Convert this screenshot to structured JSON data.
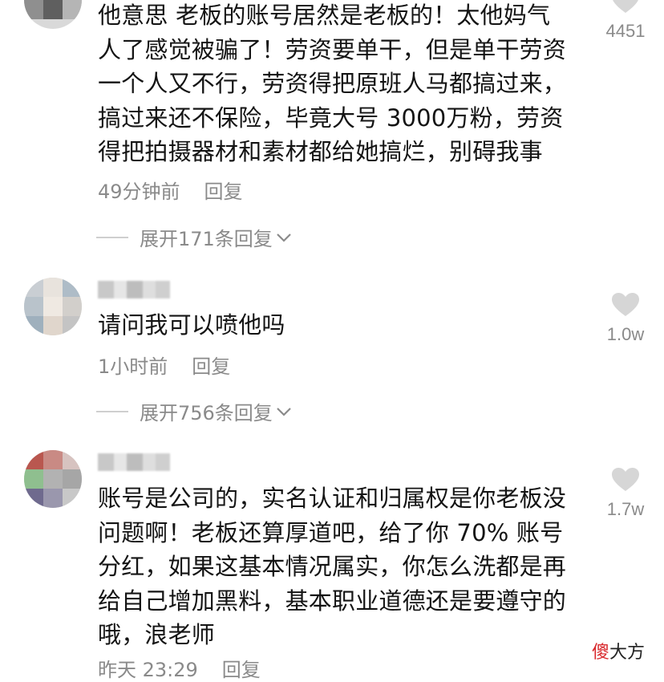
{
  "comments": [
    {
      "lines": [
        "他意思 老板的账号居然是老板的！太他妈气",
        "人了感觉被骗了！劳资要单干，但是单干劳资",
        "一个人又不行，劳资得把原班人马都搞过来，",
        "搞过来还不保险，毕竟大号 3000万粉，劳资",
        "得把拍摄器材和素材都给她搞烂，别碍我事"
      ],
      "time": "49分钟前",
      "reply_label": "回复",
      "expand_label": "展开171条回复",
      "likes": "4451"
    },
    {
      "lines": [
        "请问我可以喷他吗"
      ],
      "time": "1小时前",
      "reply_label": "回复",
      "expand_label": "展开756条回复",
      "likes": "1.0w"
    },
    {
      "lines": [
        "账号是公司的，实名认证和归属权是你老板没",
        "问题啊！老板还算厚道吧，给了你 70% 账号",
        "分红，如果这基本情况属实，你怎么洗都是再",
        "给自己增加黑料，基本职业道德还是要遵守的",
        "哦，浪老师"
      ],
      "time": "昨天 23:29",
      "reply_label": "回复",
      "likes": "1.7w"
    }
  ],
  "watermark": {
    "first": "傻",
    "rest": "大方"
  },
  "colors": {
    "meta": "#8a8a8a",
    "heart": "#d6d6d6",
    "watermark_red": "#d8262a"
  }
}
